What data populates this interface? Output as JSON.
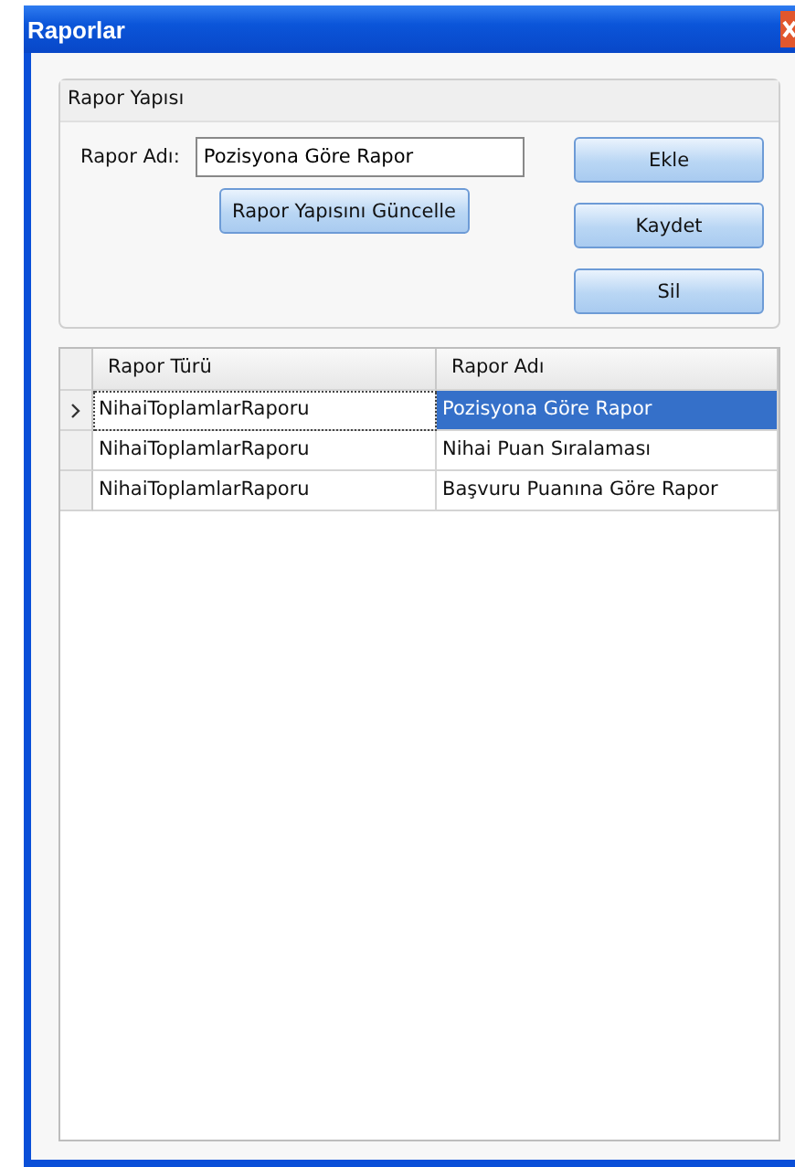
{
  "window": {
    "title": "Raporlar"
  },
  "group": {
    "title": "Rapor Yapısı",
    "field_label": "Rapor Adı:",
    "field_value": "Pozisyona Göre Rapor",
    "update_button": "Rapor Yapısını Güncelle",
    "buttons": [
      "Ekle",
      "Kaydet",
      "Sil"
    ]
  },
  "table": {
    "columns": [
      "Rapor Türü",
      "Rapor Adı"
    ],
    "rows": [
      {
        "cells": [
          "NihaiToplamlarRaporu",
          "Pozisyona Göre Rapor"
        ],
        "selected": true
      },
      {
        "cells": [
          "NihaiToplamlarRaporu",
          "Nihai Puan Sıralaması"
        ],
        "selected": false
      },
      {
        "cells": [
          "NihaiToplamlarRaporu",
          "Başvuru Puanına Göre Rapor"
        ],
        "selected": false
      }
    ]
  }
}
